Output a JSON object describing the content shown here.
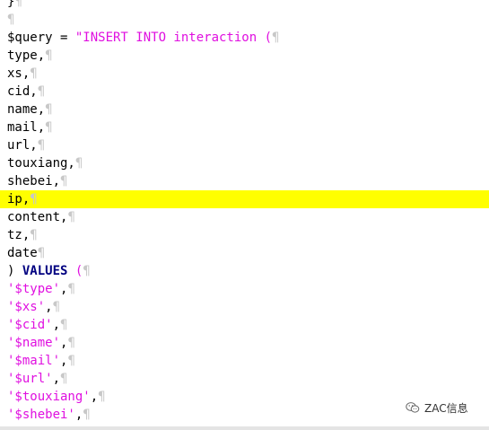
{
  "editor": {
    "pilcrow": "¶",
    "highlight_color": "#ffff00",
    "lines": [
      {
        "segments": [
          {
            "t": "}",
            "c": "plain"
          }
        ]
      },
      {
        "segments": []
      },
      {
        "segments": [
          {
            "t": "$query = ",
            "c": "plain"
          },
          {
            "t": "\"INSERT INTO interaction (",
            "c": "string"
          }
        ]
      },
      {
        "segments": [
          {
            "t": "type,",
            "c": "plain"
          }
        ]
      },
      {
        "segments": [
          {
            "t": "xs,",
            "c": "plain"
          }
        ]
      },
      {
        "segments": [
          {
            "t": "cid,",
            "c": "plain"
          }
        ]
      },
      {
        "segments": [
          {
            "t": "name,",
            "c": "plain"
          }
        ]
      },
      {
        "segments": [
          {
            "t": "mail,",
            "c": "plain"
          }
        ]
      },
      {
        "segments": [
          {
            "t": "url,",
            "c": "plain"
          }
        ]
      },
      {
        "segments": [
          {
            "t": "touxiang,",
            "c": "plain"
          }
        ]
      },
      {
        "segments": [
          {
            "t": "shebei,",
            "c": "plain"
          }
        ]
      },
      {
        "segments": [
          {
            "t": "ip,",
            "c": "plain"
          }
        ],
        "highlight": true
      },
      {
        "segments": [
          {
            "t": "content,",
            "c": "plain"
          }
        ]
      },
      {
        "segments": [
          {
            "t": "tz,",
            "c": "plain"
          }
        ]
      },
      {
        "segments": [
          {
            "t": "date",
            "c": "plain"
          }
        ]
      },
      {
        "segments": [
          {
            "t": ") ",
            "c": "plain"
          },
          {
            "t": "VALUES",
            "c": "keyword"
          },
          {
            "t": " (",
            "c": "string"
          }
        ]
      },
      {
        "segments": [
          {
            "t": "'$type'",
            "c": "string"
          },
          {
            "t": ",",
            "c": "plain"
          }
        ]
      },
      {
        "segments": [
          {
            "t": "'$xs'",
            "c": "string"
          },
          {
            "t": ",",
            "c": "plain"
          }
        ]
      },
      {
        "segments": [
          {
            "t": "'$cid'",
            "c": "string"
          },
          {
            "t": ",",
            "c": "plain"
          }
        ]
      },
      {
        "segments": [
          {
            "t": "'$name'",
            "c": "string"
          },
          {
            "t": ",",
            "c": "plain"
          }
        ]
      },
      {
        "segments": [
          {
            "t": "'$mail'",
            "c": "string"
          },
          {
            "t": ",",
            "c": "plain"
          }
        ]
      },
      {
        "segments": [
          {
            "t": "'$url'",
            "c": "string"
          },
          {
            "t": ",",
            "c": "plain"
          }
        ]
      },
      {
        "segments": [
          {
            "t": "'$touxiang'",
            "c": "string"
          },
          {
            "t": ",",
            "c": "plain"
          }
        ]
      },
      {
        "segments": [
          {
            "t": "'$shebei'",
            "c": "string"
          },
          {
            "t": ",",
            "c": "plain"
          }
        ]
      }
    ]
  },
  "watermark": {
    "icon": "wechat-icon",
    "text": "ZAC信息"
  }
}
